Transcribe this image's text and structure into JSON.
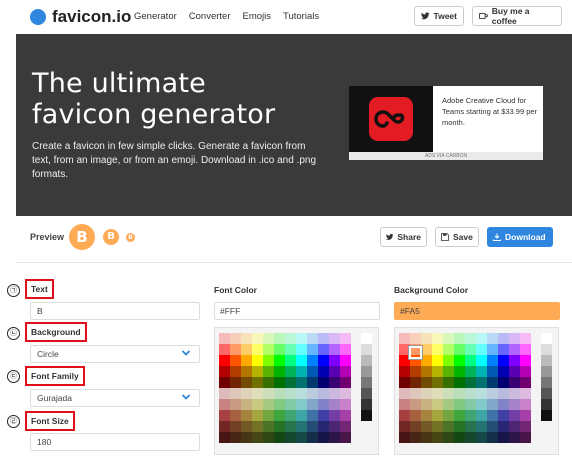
{
  "header": {
    "logo_text": "favicon.io",
    "nav": [
      "Generator",
      "Converter",
      "Emojis",
      "Tutorials"
    ],
    "tweet_label": "Tweet",
    "coffee_label": "Buy me a coffee"
  },
  "hero": {
    "title_line1": "The ultimate",
    "title_line2": "favicon generator",
    "subtitle": "Create a favicon in few simple clicks. Generate a favicon from text, from an image, or from an emoji. Download in .ico and .png formats.",
    "ad_text": "Adobe Creative Cloud for Teams starting at $33.99 per month.",
    "ad_footer": "ADS VIA CARBON"
  },
  "preview": {
    "label": "Preview",
    "letter": "B",
    "share_label": "Share",
    "save_label": "Save",
    "download_label": "Download"
  },
  "form": {
    "annotations": [
      "㉠",
      "㉡",
      "㉢",
      "㉣"
    ],
    "text_label": "Text",
    "text_value": "B",
    "background_label": "Background",
    "background_value": "Circle",
    "font_family_label": "Font Family",
    "font_family_value": "Gurajada",
    "font_size_label": "Font Size",
    "font_size_value": "180",
    "font_color_label": "Font Color",
    "font_color_value": "#FFF",
    "bg_color_label": "Background Color",
    "bg_color_value": "#FA5"
  },
  "colors": {
    "accent": "#2e86de",
    "bg_color_swatch": "#FFAA55",
    "hero_bg": "#3a3a3a",
    "highlight": "#e0101a"
  },
  "icons": [
    "twitter-icon",
    "coffee-icon",
    "share-icon",
    "save-icon",
    "download-icon",
    "chevron-down-icon"
  ]
}
